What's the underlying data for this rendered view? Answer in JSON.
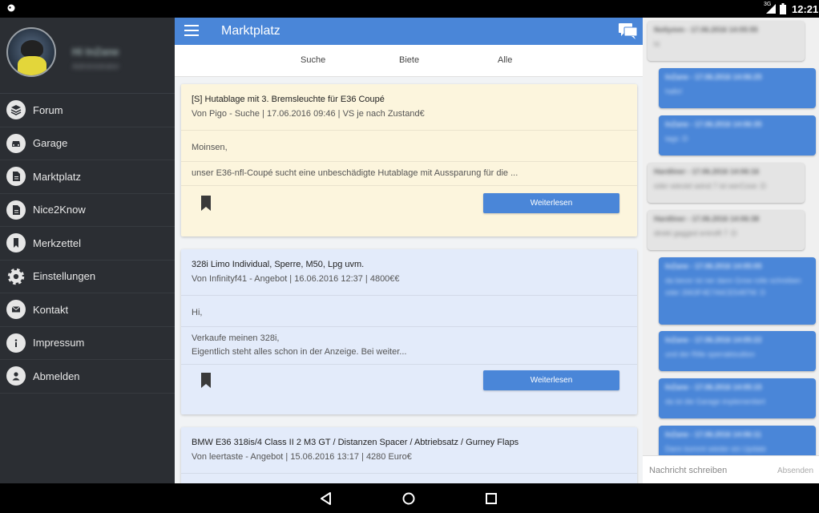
{
  "status": {
    "time": "12:21",
    "signal": "3G",
    "app_icon": "notification-icon",
    "signal_icon": "signal-icon",
    "battery_icon": "battery-icon"
  },
  "drawer": {
    "user_name": "Hi InZane",
    "user_role": "Administrator",
    "items": [
      {
        "label": "Forum",
        "icon": "layers-icon"
      },
      {
        "label": "Garage",
        "icon": "car-icon"
      },
      {
        "label": "Marktplatz",
        "icon": "document-icon"
      },
      {
        "label": "Nice2Know",
        "icon": "document-icon"
      },
      {
        "label": "Merkzettel",
        "icon": "bookmark-icon"
      },
      {
        "label": "Einstellungen",
        "icon": "gear-icon"
      },
      {
        "label": "Kontakt",
        "icon": "mail-icon"
      },
      {
        "label": "Impressum",
        "icon": "info-icon"
      },
      {
        "label": "Abmelden",
        "icon": "person-icon"
      }
    ]
  },
  "appbar": {
    "title": "Marktplatz",
    "menu_icon": "hamburger-menu-icon",
    "chat_icon": "chat-icon"
  },
  "tabs": [
    "Suche",
    "Biete",
    "Alle"
  ],
  "cards": [
    {
      "title": "[S] Hutablage mit 3. Bremsleuchte für E36 Coupé",
      "subtitle": "Von Pigo - Suche | 17.06.2016 09:46 | VS je nach Zustand€",
      "lines": [
        "Moinsen,",
        "unser E36-nfl-Coupé sucht eine unbeschädigte Hutablage mit Aussparung für die ..."
      ],
      "button": "Weiterlesen",
      "color": "#fcf5dd"
    },
    {
      "title": "328i Limo Individual, Sperre, M50, Lpg uvm.",
      "subtitle": "Von Infinityf41 - Angebot | 16.06.2016 12:37 | 4800€€",
      "lines": [
        "Hi,",
        "Verkaufe meinen 328i,",
        "Eigentlich steht alles schon in der Anzeige. Bei weiter..."
      ],
      "button": "Weiterlesen",
      "color": "#e3ebfa"
    },
    {
      "title": "BMW E36 318is/4 Class II 2 M3 GT / Distanzen Spacer / Abtriebsatz / Gurney Flaps",
      "subtitle": "Von leertaste - Angebot | 15.06.2016 13:17 | 4280 Euro€",
      "color": "#e3ebfa"
    }
  ],
  "chat": {
    "messages": [
      {
        "side": "gray",
        "header": "Nollymm - 17.06.2016 14:05:55",
        "text": "hi"
      },
      {
        "side": "blue",
        "header": "InZane - 17.06.2016 14:06:25",
        "text": "hallo!"
      },
      {
        "side": "blue",
        "header": "InZane - 17.06.2016 14:06:35",
        "text": "tags :D"
      },
      {
        "side": "gray",
        "header": "Hardliner - 17.06.2016 14:06:16",
        "text": "oder wieviel seind 7 ist werCose :D"
      },
      {
        "side": "gray",
        "header": "Hardliner - 17.06.2016 14:06:38",
        "text": "direkt gagged entrolft 7 :D"
      },
      {
        "side": "blue",
        "header": "InZane - 17.06.2016 14:05:05",
        "text": "da bevor ist ner dann Grow rolle schreiben oder 2663F4E7A6CE5487W. D"
      },
      {
        "side": "blue",
        "header": "InZane - 17.06.2016 14:05:22",
        "text": "und der Rille sperraktoultion"
      },
      {
        "side": "blue",
        "header": "InZane - 17.06.2016 14:05:15",
        "text": "da ist die Garage implementiert"
      },
      {
        "side": "blue",
        "header": "InZane - 17.06.2016 14:06:11",
        "text": "Dann kommt wieder ein Update"
      }
    ],
    "input_placeholder": "Nachricht schreiben",
    "send_label": "Absenden"
  },
  "navbar": {
    "back_icon": "back-icon",
    "home_icon": "home-icon",
    "recents_icon": "recents-icon"
  }
}
